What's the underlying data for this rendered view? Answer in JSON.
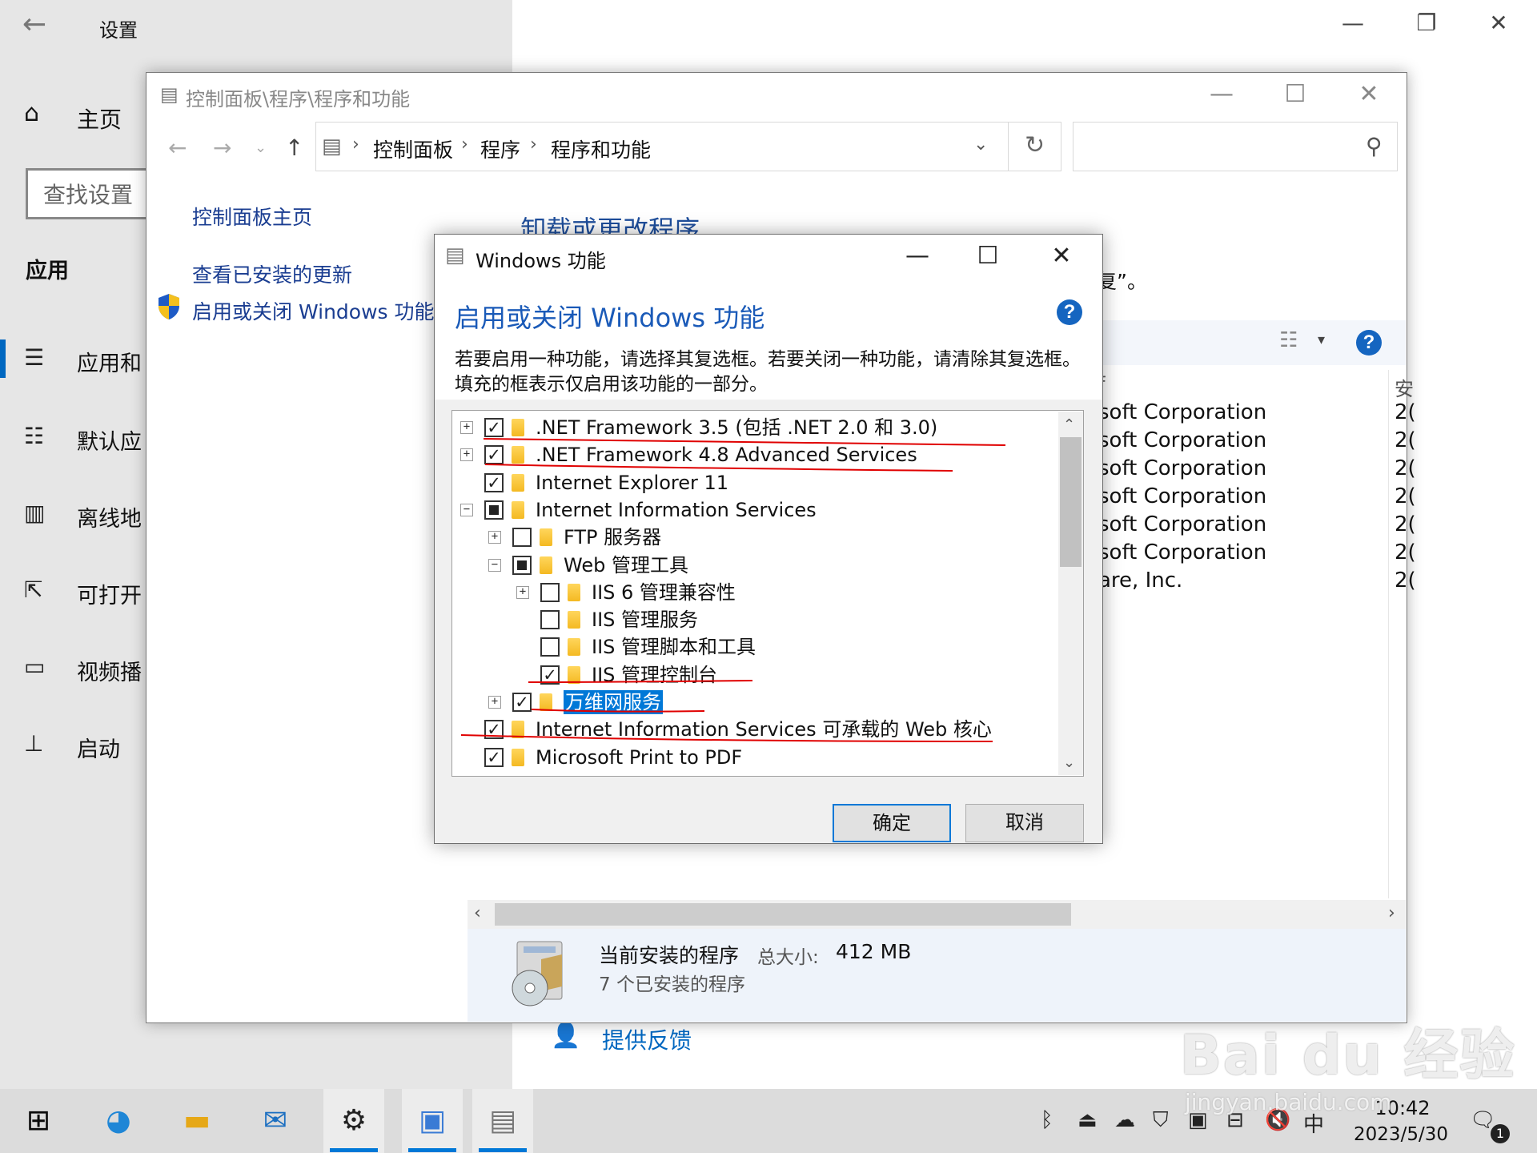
{
  "settings": {
    "title": "设置",
    "home": "主页",
    "search_placeholder": "查找设置",
    "section": "应用",
    "nav": [
      {
        "icon": "apps-features-icon",
        "glyph": "☰",
        "label": "应用和"
      },
      {
        "icon": "default-apps-icon",
        "glyph": "☷",
        "label": "默认应"
      },
      {
        "icon": "offline-maps-icon",
        "glyph": "▥",
        "label": "离线地"
      },
      {
        "icon": "apps-for-websites-icon",
        "glyph": "⇱",
        "label": "可打开"
      },
      {
        "icon": "video-playback-icon",
        "glyph": "▭",
        "label": "视频播"
      },
      {
        "icon": "startup-icon",
        "glyph": "⊥",
        "label": "启动"
      }
    ],
    "feedback": "提供反馈"
  },
  "control_panel": {
    "title": "控制面板\\程序\\程序和功能",
    "breadcrumb": [
      "控制面板",
      "程序",
      "程序和功能"
    ],
    "sidebar_links": {
      "home": "控制面板主页",
      "updates": "查看已安装的更新",
      "features": "启用或关闭 Windows 功能"
    },
    "heading": "卸载或更改程序",
    "desc_tail": "复”。",
    "list_header_pub": "f",
    "list_header_date": "安",
    "list_rows": [
      {
        "publisher": "soft Corporation",
        "date": "2("
      },
      {
        "publisher": "soft Corporation",
        "date": "2("
      },
      {
        "publisher": "soft Corporation",
        "date": "2("
      },
      {
        "publisher": "soft Corporation",
        "date": "2("
      },
      {
        "publisher": "soft Corporation",
        "date": "2("
      },
      {
        "publisher": "soft Corporation",
        "date": "2("
      },
      {
        "publisher": "are, Inc.",
        "date": "2("
      }
    ],
    "details": {
      "label": "当前安装的程序",
      "size_label": "总大小:",
      "size": "412 MB",
      "count": "7 个已安装的程序"
    }
  },
  "windows_features": {
    "title": "Windows 功能",
    "heading": "启用或关闭 Windows 功能",
    "instructions": "若要启用一种功能，请选择其复选框。若要关闭一种功能，请清除其复选框。填充的框表示仅启用该功能的一部分。",
    "tree": [
      {
        "level": 0,
        "expander": "+",
        "state": "checked",
        "label": ".NET Framework 3.5 (包括 .NET 2.0 和 3.0)"
      },
      {
        "level": 0,
        "expander": "+",
        "state": "checked",
        "label": ".NET Framework 4.8 Advanced Services"
      },
      {
        "level": 0,
        "expander": "",
        "state": "checked",
        "label": "Internet Explorer 11"
      },
      {
        "level": 0,
        "expander": "−",
        "state": "partial",
        "label": "Internet Information Services"
      },
      {
        "level": 1,
        "expander": "+",
        "state": "unchecked",
        "label": "FTP 服务器"
      },
      {
        "level": 1,
        "expander": "−",
        "state": "partial",
        "label": "Web 管理工具"
      },
      {
        "level": 2,
        "expander": "+",
        "state": "unchecked",
        "label": "IIS 6 管理兼容性"
      },
      {
        "level": 2,
        "expander": "",
        "state": "unchecked",
        "label": "IIS 管理服务"
      },
      {
        "level": 2,
        "expander": "",
        "state": "unchecked",
        "label": "IIS 管理脚本和工具"
      },
      {
        "level": 2,
        "expander": "",
        "state": "checked",
        "label": "IIS 管理控制台"
      },
      {
        "level": 1,
        "expander": "+",
        "state": "checked",
        "label": "万维网服务",
        "selected": true
      },
      {
        "level": 0,
        "expander": "",
        "state": "checked",
        "label": "Internet Information Services 可承载的 Web 核心"
      },
      {
        "level": 0,
        "expander": "",
        "state": "checked",
        "label": "Microsoft Print to PDF"
      }
    ],
    "ok": "确定",
    "cancel": "取消"
  },
  "taskbar": {
    "apps": [
      {
        "name": "start-button",
        "glyph": "⊞"
      },
      {
        "name": "edge-icon",
        "glyph": "◕"
      },
      {
        "name": "file-explorer-icon",
        "glyph": "▬"
      },
      {
        "name": "mail-icon",
        "glyph": "✉"
      },
      {
        "name": "settings-app-icon",
        "glyph": "⚙"
      },
      {
        "name": "control-panel-app-icon",
        "glyph": "▣"
      },
      {
        "name": "programs-features-app-icon",
        "glyph": "▤"
      }
    ],
    "tray": {
      "ime": "中",
      "time": "10:42",
      "date": "2023/5/30",
      "notification_count": "1"
    }
  },
  "watermark": {
    "logo": "Bai du 经验",
    "url": "jingyan.baidu.com"
  },
  "colors": {
    "accent": "#0078d7",
    "link": "#1a3d91",
    "heading_blue": "#1a5ab8",
    "annotation_red": "#e00000",
    "selection": "#0078d7"
  }
}
